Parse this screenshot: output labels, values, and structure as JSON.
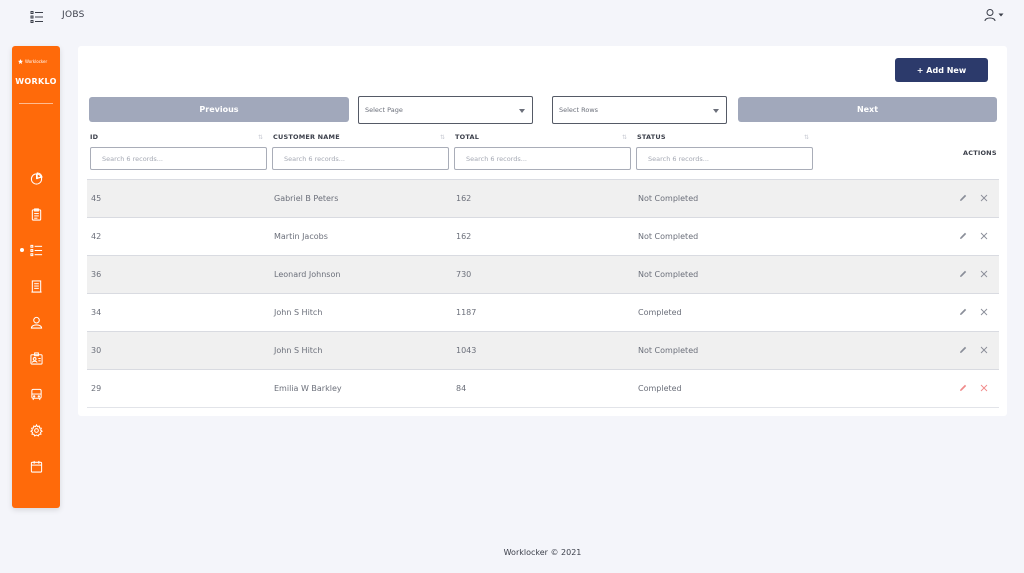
{
  "topbar": {
    "title": "JOBS",
    "menu_icon": "list-menu-icon",
    "user_icon": "user-icon"
  },
  "sidebar": {
    "logo_small": "Worklocker",
    "logo_text": "WORKLO",
    "items": [
      {
        "icon": "dashboard-pie-icon",
        "active": false
      },
      {
        "icon": "clipboard-icon",
        "active": false
      },
      {
        "icon": "jobs-list-icon",
        "active": true
      },
      {
        "icon": "document-icon",
        "active": false
      },
      {
        "icon": "user-icon",
        "active": false
      },
      {
        "icon": "id-badge-icon",
        "active": false
      },
      {
        "icon": "bus-icon",
        "active": false
      },
      {
        "icon": "gear-icon",
        "active": false
      },
      {
        "icon": "calendar-icon",
        "active": false
      }
    ]
  },
  "toolbar": {
    "add_new_label": "+ Add New",
    "previous_label": "Previous",
    "next_label": "Next",
    "select_page_placeholder": "Select Page",
    "select_rows_placeholder": "Select Rows"
  },
  "table": {
    "columns": {
      "id": "ID",
      "customer_name": "CUSTOMER NAME",
      "total": "TOTAL",
      "status": "STATUS",
      "actions": "ACTIONS"
    },
    "filter_placeholder": "Search 6 records...",
    "rows": [
      {
        "id": "45",
        "customer_name": "Gabriel B Peters",
        "total": "162",
        "status": "Not Completed"
      },
      {
        "id": "42",
        "customer_name": "Martin Jacobs",
        "total": "162",
        "status": "Not Completed"
      },
      {
        "id": "36",
        "customer_name": "Leonard Johnson",
        "total": "730",
        "status": "Not Completed"
      },
      {
        "id": "34",
        "customer_name": "John S Hitch",
        "total": "1187",
        "status": "Completed"
      },
      {
        "id": "30",
        "customer_name": "John S Hitch",
        "total": "1043",
        "status": "Not Completed"
      },
      {
        "id": "29",
        "customer_name": "Emilia W Barkley",
        "total": "84",
        "status": "Completed"
      }
    ]
  },
  "colors": {
    "sidebar": "#ff6a0a",
    "primary_button": "#2c3a6b",
    "pager_button": "#a1a8bb",
    "action_icon": "#8a8e99",
    "action_icon_hover": "#f08a8a"
  },
  "footer": {
    "text": "Worklocker © 2021"
  }
}
